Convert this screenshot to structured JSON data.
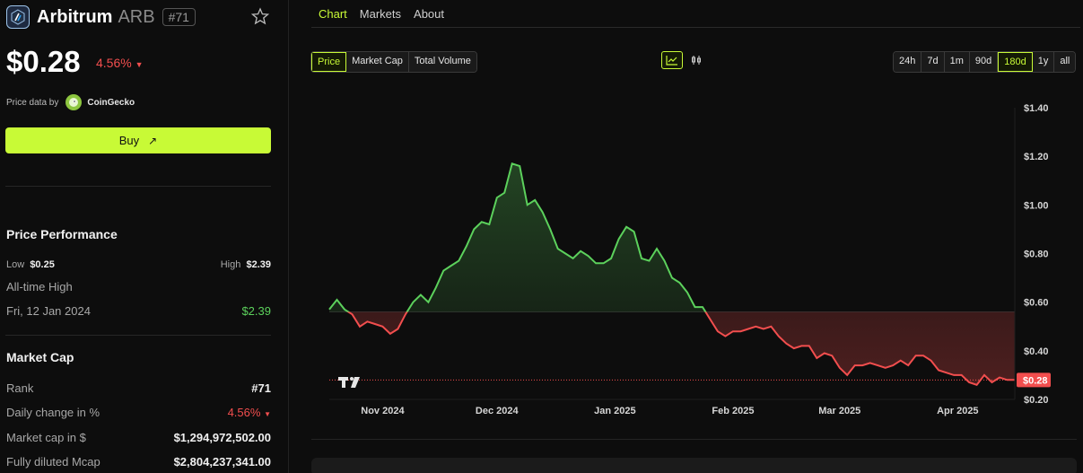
{
  "coin": {
    "name": "Arbitrum",
    "symbol": "ARB",
    "rank_badge": "#71",
    "price": "$0.28",
    "change": "4.56%",
    "price_data_label": "Price data by",
    "provider": "CoinGecko",
    "buy_label": "Buy"
  },
  "performance": {
    "title": "Price Performance",
    "low_label": "Low",
    "low_value": "$0.25",
    "high_label": "High",
    "high_value": "$2.39",
    "ath_label": "All-time High",
    "ath_date": "Fri, 12 Jan 2024",
    "ath_value": "$2.39"
  },
  "market_cap": {
    "title": "Market Cap",
    "rows": [
      {
        "label": "Rank",
        "value": "#71"
      },
      {
        "label": "Daily change in %",
        "value": "4.56%"
      },
      {
        "label": "Market cap in $",
        "value": "$1,294,972,502.00"
      },
      {
        "label": "Fully diluted Mcap",
        "value": "$2,804,237,341.00"
      }
    ]
  },
  "tabs": [
    "Chart",
    "Markets",
    "About"
  ],
  "metric_buttons": [
    "Price",
    "Market Cap",
    "Total Volume"
  ],
  "range_buttons": [
    "24h",
    "7d",
    "1m",
    "90d",
    "180d",
    "1y",
    "all"
  ],
  "colors": {
    "accent": "#c8fa36",
    "up": "#5cd15c",
    "down": "#f24e4e",
    "background": "#0d0d0d"
  },
  "icons": {
    "star": "star-icon",
    "line_chart": "line-chart-icon",
    "candle_chart": "candlestick-icon",
    "external": "arrow-up-right-icon",
    "watermark": "tradingview-logo"
  },
  "chart_data": {
    "type": "area",
    "title": "",
    "xlabel": "",
    "ylabel": "",
    "x_ticks": [
      "Nov 2024",
      "Dec 2024",
      "Jan 2025",
      "Feb 2025",
      "Mar 2025",
      "Apr 2025"
    ],
    "y_ticks": [
      "$1.40",
      "$1.20",
      "$1.00",
      "$0.80",
      "$0.60",
      "$0.40",
      "$0.20"
    ],
    "ylim": [
      0.2,
      1.4
    ],
    "baseline": 0.56,
    "current_price_label": "$0.28",
    "current_price": 0.28,
    "up_color": "#5cd15c",
    "down_color": "#f24e4e",
    "series": [
      {
        "x": [
          "2024-10-18",
          "2024-10-20",
          "2024-10-22",
          "2024-10-24",
          "2024-10-26",
          "2024-10-28",
          "2024-10-30",
          "2024-11-01",
          "2024-11-03",
          "2024-11-05",
          "2024-11-07",
          "2024-11-09",
          "2024-11-11",
          "2024-11-13",
          "2024-11-15",
          "2024-11-17",
          "2024-11-19",
          "2024-11-21",
          "2024-11-23",
          "2024-11-25",
          "2024-11-27",
          "2024-11-29",
          "2024-12-01",
          "2024-12-03",
          "2024-12-05",
          "2024-12-07",
          "2024-12-09",
          "2024-12-11",
          "2024-12-13",
          "2024-12-15",
          "2024-12-17",
          "2024-12-19",
          "2024-12-21",
          "2024-12-23",
          "2024-12-25",
          "2024-12-27",
          "2024-12-29",
          "2024-12-31",
          "2025-01-02",
          "2025-01-04",
          "2025-01-06",
          "2025-01-08",
          "2025-01-10",
          "2025-01-12",
          "2025-01-14",
          "2025-01-16",
          "2025-01-18",
          "2025-01-20",
          "2025-01-22",
          "2025-01-24",
          "2025-01-26",
          "2025-01-28",
          "2025-01-30",
          "2025-02-01",
          "2025-02-03",
          "2025-02-05",
          "2025-02-07",
          "2025-02-09",
          "2025-02-11",
          "2025-02-13",
          "2025-02-15",
          "2025-02-17",
          "2025-02-19",
          "2025-02-21",
          "2025-02-23",
          "2025-02-25",
          "2025-02-27",
          "2025-03-01",
          "2025-03-03",
          "2025-03-05",
          "2025-03-07",
          "2025-03-09",
          "2025-03-11",
          "2025-03-13",
          "2025-03-15",
          "2025-03-17",
          "2025-03-19",
          "2025-03-21",
          "2025-03-23",
          "2025-03-25",
          "2025-03-27",
          "2025-03-29",
          "2025-03-31",
          "2025-04-02",
          "2025-04-04",
          "2025-04-06",
          "2025-04-08",
          "2025-04-10",
          "2025-04-12",
          "2025-04-14",
          "2025-04-16"
        ],
        "y": [
          0.57,
          0.61,
          0.57,
          0.55,
          0.5,
          0.52,
          0.51,
          0.5,
          0.47,
          0.49,
          0.55,
          0.6,
          0.63,
          0.6,
          0.66,
          0.73,
          0.75,
          0.77,
          0.83,
          0.9,
          0.93,
          0.92,
          1.03,
          1.05,
          1.17,
          1.16,
          1.0,
          1.02,
          0.97,
          0.9,
          0.82,
          0.8,
          0.78,
          0.81,
          0.79,
          0.76,
          0.76,
          0.78,
          0.86,
          0.91,
          0.89,
          0.78,
          0.77,
          0.82,
          0.77,
          0.7,
          0.68,
          0.64,
          0.58,
          0.58,
          0.53,
          0.48,
          0.46,
          0.48,
          0.48,
          0.49,
          0.5,
          0.49,
          0.5,
          0.46,
          0.43,
          0.41,
          0.42,
          0.42,
          0.37,
          0.39,
          0.38,
          0.33,
          0.3,
          0.34,
          0.34,
          0.35,
          0.34,
          0.33,
          0.34,
          0.36,
          0.34,
          0.38,
          0.38,
          0.36,
          0.32,
          0.31,
          0.3,
          0.3,
          0.27,
          0.26,
          0.3,
          0.27,
          0.29,
          0.28,
          0.28
        ]
      }
    ]
  }
}
